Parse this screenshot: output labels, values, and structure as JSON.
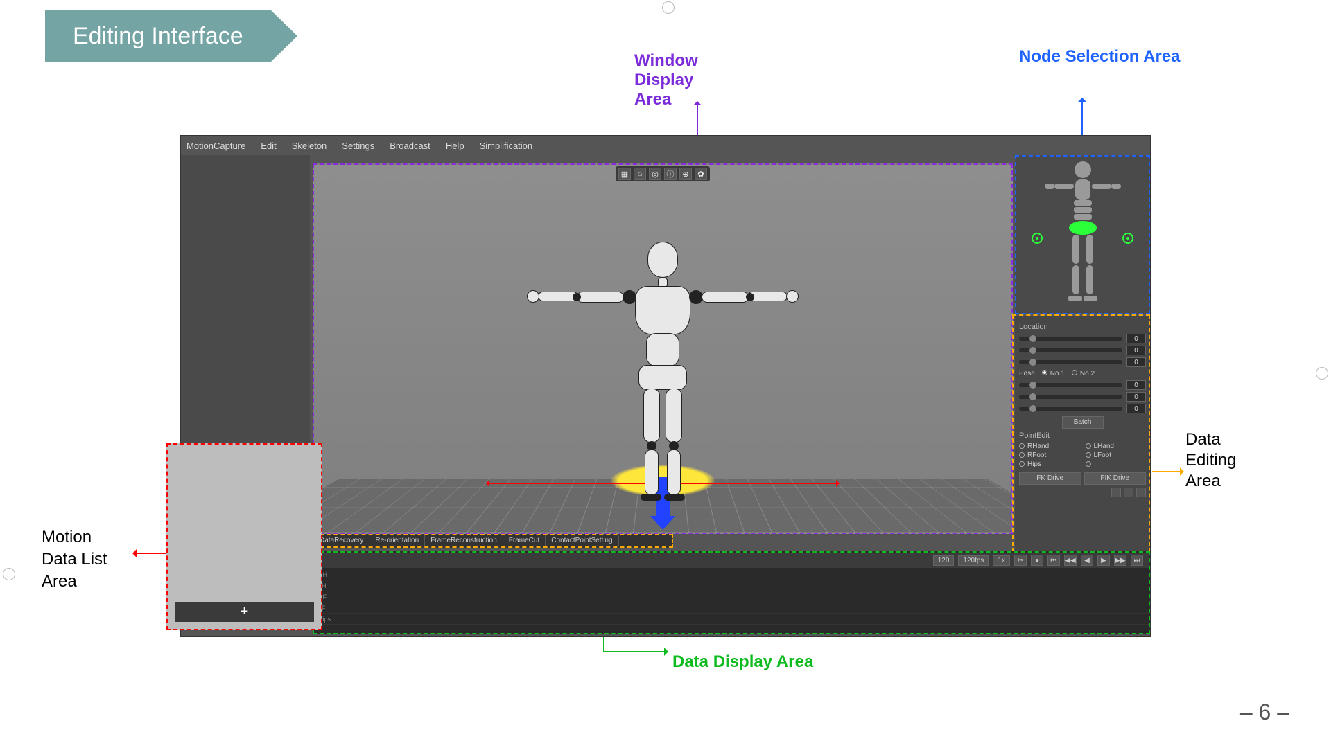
{
  "slide": {
    "title": "Editing Interface",
    "page_number": "6"
  },
  "callouts": {
    "window_display": "Window\nDisplay\nArea",
    "node_selection": "Node Selection Area",
    "data_editing": "Data\nEditing\nArea",
    "motion_data_list": "Motion\nData List\nArea",
    "data_display": "Data Display Area"
  },
  "regions": {
    "window_color": "#7b2bd9",
    "node_color": "#1e62ff",
    "data_editing_color": "#ffaa00",
    "motion_list_color": "#ff0000",
    "data_display_color": "#0dbb1f"
  },
  "editor": {
    "menubar": [
      "MotionCapture",
      "Edit",
      "Skeleton",
      "Settings",
      "Broadcast",
      "Help",
      "Simplification"
    ],
    "viewport_tool_icons": [
      "grid-icon",
      "camera-icon",
      "target-icon",
      "info-icon",
      "add-icon",
      "settings-icon"
    ],
    "edit_tabs": [
      "DataRecovery",
      "Re-orientation",
      "FrameReconstruction",
      "FrameCut",
      "ContactPointSetting"
    ]
  },
  "node_selection_panel": {
    "selected_part": "pelvis"
  },
  "properties": {
    "location_label": "Location",
    "location_values": [
      "0",
      "0",
      "0"
    ],
    "pose_label": "Pose",
    "pose_options": [
      "No.1",
      "No.2"
    ],
    "pose_selected": "No.1",
    "pose_values": [
      "0",
      "0",
      "0"
    ],
    "batch_label": "Batch",
    "point_edit_label": "PointEdit",
    "point_edit_items": [
      "RHand",
      "LHand",
      "RFoot",
      "LFoot",
      "Hips"
    ],
    "drive_buttons": [
      "FK Drive",
      "FIK Drive"
    ]
  },
  "timeline": {
    "frame_field": "120",
    "fps_label": "120fps",
    "speed_label": "1x",
    "track_labels": [
      "RH",
      "LH",
      "RF",
      "LF",
      "Hips"
    ],
    "transport_icons": [
      "record-icon",
      "skip-start-icon",
      "step-back-icon",
      "play-back-icon",
      "play-icon",
      "step-fwd-icon",
      "skip-end-icon"
    ]
  },
  "motion_list": {
    "add_label": "+"
  }
}
